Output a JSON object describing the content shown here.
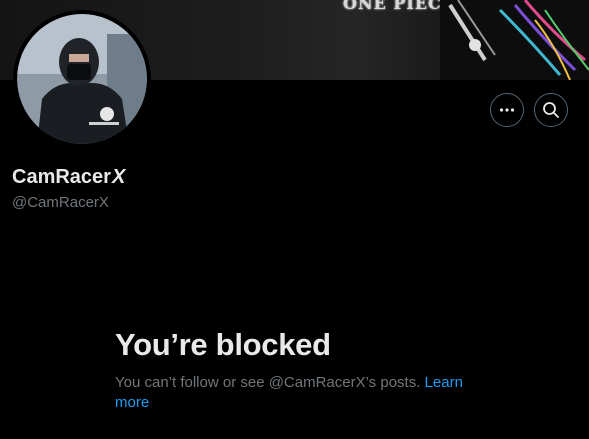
{
  "banner": {
    "logo_text": "ONE PIECE"
  },
  "profile": {
    "display_name": "CamRacer",
    "name_badge": "X",
    "handle": "@CamRacerX"
  },
  "actions": {
    "more_icon": "more-horizontal-icon",
    "search_icon": "search-icon"
  },
  "blocked": {
    "title": "You’re blocked",
    "message": "You can’t follow or see @CamRacerX’s posts.",
    "link_label": "Learn more"
  },
  "colors": {
    "background": "#000000",
    "text_primary": "#e7e9ea",
    "text_secondary": "#71767b",
    "link": "#1d9bf0",
    "button_border": "#536471"
  }
}
